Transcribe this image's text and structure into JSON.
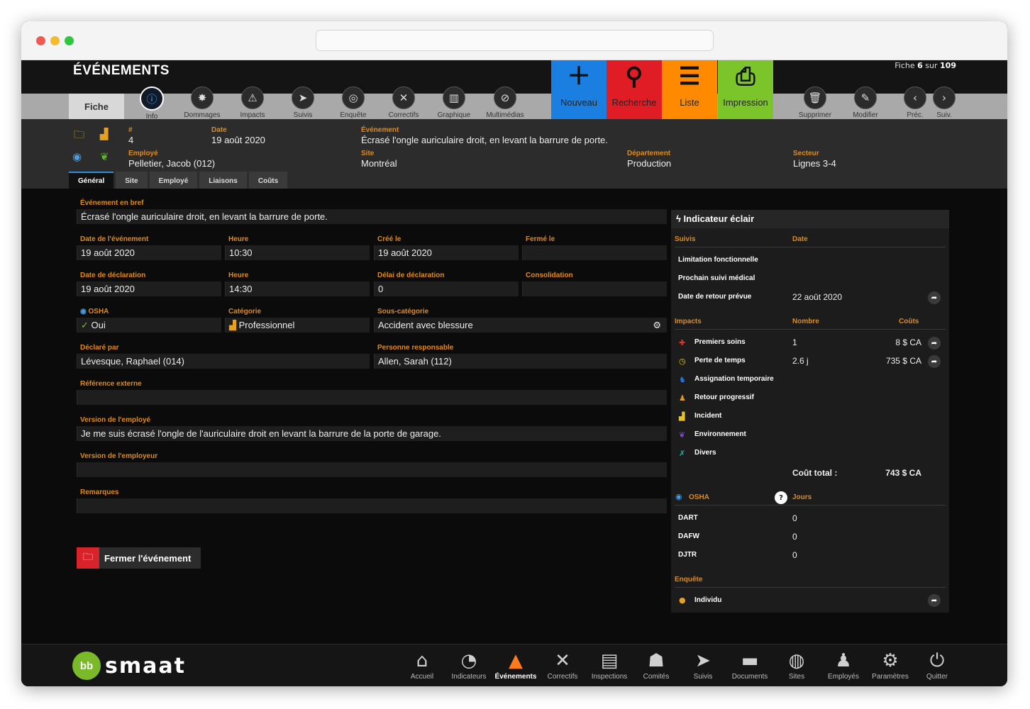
{
  "header": {
    "title": "ÉVÉNEMENTS",
    "record_prefix": "Fiche",
    "record_current": "6",
    "record_sep": "sur",
    "record_total": "109",
    "fiche_tab": "Fiche"
  },
  "toolbar": {
    "tabs": [
      {
        "label": "Info",
        "icon": "info-icon"
      },
      {
        "label": "Dommages",
        "icon": "damage-icon"
      },
      {
        "label": "Impacts",
        "icon": "warning-icon"
      },
      {
        "label": "Suivis",
        "icon": "paper-plane-icon"
      },
      {
        "label": "Enquête",
        "icon": "fingerprint-icon"
      },
      {
        "label": "Correctifs",
        "icon": "tools-icon"
      },
      {
        "label": "Graphique",
        "icon": "chart-icon"
      },
      {
        "label": "Multimédias",
        "icon": "paperclip-icon"
      }
    ],
    "big_buttons": [
      {
        "label": "Nouveau",
        "color": "#1a7fe0",
        "icon": "plus-icon"
      },
      {
        "label": "Recherche",
        "color": "#e01c24",
        "icon": "search-icon"
      },
      {
        "label": "Liste",
        "color": "#ff8a00",
        "icon": "list-icon"
      },
      {
        "label": "Impression",
        "color": "#7bc42a",
        "icon": "printer-icon"
      }
    ],
    "right_tools": [
      {
        "label": "Supprimer",
        "icon": "trash-icon"
      },
      {
        "label": "Modifier",
        "icon": "pencil-icon"
      },
      {
        "label": "Préc.",
        "icon": "chevron-left-icon"
      },
      {
        "label": "Suiv.",
        "icon": "chevron-right-icon"
      }
    ]
  },
  "summary": {
    "number_label": "#",
    "number": "4",
    "date_label": "Date",
    "date": "19 août 2020",
    "event_label": "Événement",
    "event": "Écrasé l'ongle auriculaire droit, en levant la barrure de porte.",
    "employee_label": "Employé",
    "employee": "Pelletier, Jacob (012)",
    "site_label": "Site",
    "site": "Montréal",
    "department_label": "Département",
    "department": "Production",
    "sector_label": "Secteur",
    "sector": "Lignes 3-4"
  },
  "subtabs": [
    "Général",
    "Site",
    "Employé",
    "Liaisons",
    "Coûts"
  ],
  "general": {
    "brief_label": "Événement en bref",
    "brief": "Écrasé l'ongle auriculaire droit, en levant la barrure de porte.",
    "event_date_label": "Date de l'événement",
    "event_date": "19 août 2020",
    "hour1_label": "Heure",
    "hour1": "10:30",
    "created_label": "Créé le",
    "created": "19 août 2020",
    "closed_label": "Fermé le",
    "closed": "",
    "decl_date_label": "Date de déclaration",
    "decl_date": "19 août 2020",
    "hour2_label": "Heure",
    "hour2": "14:30",
    "delay_label": "Délai de déclaration",
    "delay": "0",
    "consolidation_label": "Consolidation",
    "consolidation": "",
    "osha_label": "OSHA",
    "osha": "Oui",
    "category_label": "Catégorie",
    "category": "Professionnel",
    "subcategory_label": "Sous-catégorie",
    "subcategory": "Accident avec blessure",
    "declared_by_label": "Déclaré par",
    "declared_by": "Lévesque, Raphael (014)",
    "responsible_label": "Personne responsable",
    "responsible": "Allen, Sarah (112)",
    "ext_ref_label": "Référence externe",
    "ext_ref": "",
    "employee_version_label": "Version de l'employé",
    "employee_version": "Je me suis écrasé l'ongle de l'auriculaire droit en levant la barrure de la porte de garage.",
    "employer_version_label": "Version de l'employeur",
    "employer_version": "",
    "remarks_label": "Remarques",
    "remarks": "",
    "close_button": "Fermer l'événement"
  },
  "indicator": {
    "title": "Indicateur éclair",
    "suivis_header": "Suivis",
    "date_header": "Date",
    "suivis": [
      {
        "label": "Limitation fonctionnelle",
        "date": ""
      },
      {
        "label": "Prochain suivi médical",
        "date": ""
      },
      {
        "label": "Date de retour prévue",
        "date": "22 août 2020"
      }
    ],
    "impacts_header": "Impacts",
    "count_header": "Nombre",
    "cost_header": "Coûts",
    "impacts": [
      {
        "label": "Premiers soins",
        "count": "1",
        "cost": "8 $ CA",
        "icon": "first-aid-icon",
        "color": "#e0332b"
      },
      {
        "label": "Perte de temps",
        "count": "2.6 j",
        "cost": "735 $ CA",
        "icon": "clock-icon",
        "color": "#e8c020"
      },
      {
        "label": "Assignation temporaire",
        "count": "",
        "cost": "",
        "icon": "person-walk-icon",
        "color": "#2f6fd8"
      },
      {
        "label": "Retour progressif",
        "count": "",
        "cost": "",
        "icon": "person-return-icon",
        "color": "#e89a20"
      },
      {
        "label": "Incident",
        "count": "",
        "cost": "",
        "icon": "factory-icon",
        "color": "#e8c020"
      },
      {
        "label": "Environnement",
        "count": "",
        "cost": "",
        "icon": "leaf-icon",
        "color": "#7a4fc8"
      },
      {
        "label": "Divers",
        "count": "",
        "cost": "",
        "icon": "misc-icon",
        "color": "#20b0a0"
      }
    ],
    "total_label": "Coût total :",
    "total": "743 $ CA",
    "osha_header": "OSHA",
    "days_header": "Jours",
    "osha_rows": [
      {
        "label": "DART",
        "value": "0"
      },
      {
        "label": "DAFW",
        "value": "0"
      },
      {
        "label": "DJTR",
        "value": "0"
      }
    ],
    "investigation_header": "Enquête",
    "investigation_row": "Individu"
  },
  "footer": {
    "logo_badge": "bb",
    "logo_text": "smaat",
    "nav": [
      {
        "label": "Accueil",
        "icon": "home-icon"
      },
      {
        "label": "Indicateurs",
        "icon": "gauge-icon"
      },
      {
        "label": "Événements",
        "icon": "cone-icon"
      },
      {
        "label": "Correctifs",
        "icon": "tools-icon"
      },
      {
        "label": "Inspections",
        "icon": "clipboard-icon"
      },
      {
        "label": "Comités",
        "icon": "group-icon"
      },
      {
        "label": "Suivis",
        "icon": "paper-plane-icon"
      },
      {
        "label": "Documents",
        "icon": "folder-icon"
      },
      {
        "label": "Sites",
        "icon": "globe-icon"
      },
      {
        "label": "Employés",
        "icon": "employee-icon"
      },
      {
        "label": "Paramètres",
        "icon": "gear-icon"
      },
      {
        "label": "Quitter",
        "icon": "power-icon"
      }
    ]
  }
}
